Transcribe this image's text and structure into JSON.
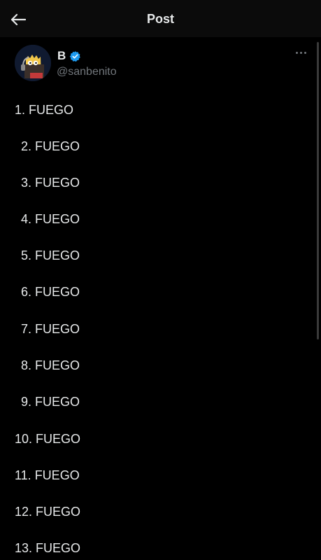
{
  "header": {
    "title": "Post",
    "back_icon": "arrow-left-icon"
  },
  "author": {
    "display_name": "B",
    "handle": "@sanbenito",
    "verified_icon": "verified-badge-icon",
    "verified_color": "#1d9bf0"
  },
  "post": {
    "lines": [
      "1. FUEGO",
      "2. FUEGO",
      "3. FUEGO",
      "4. FUEGO",
      "5. FUEGO",
      "6. FUEGO",
      "7. FUEGO",
      "8. FUEGO",
      "9. FUEGO",
      "10. FUEGO",
      "11. FUEGO",
      "12. FUEGO",
      "13. FUEGO"
    ]
  },
  "colors": {
    "background": "#000000",
    "text": "#e7e9ea",
    "muted": "#71767b",
    "accent": "#1d9bf0"
  }
}
